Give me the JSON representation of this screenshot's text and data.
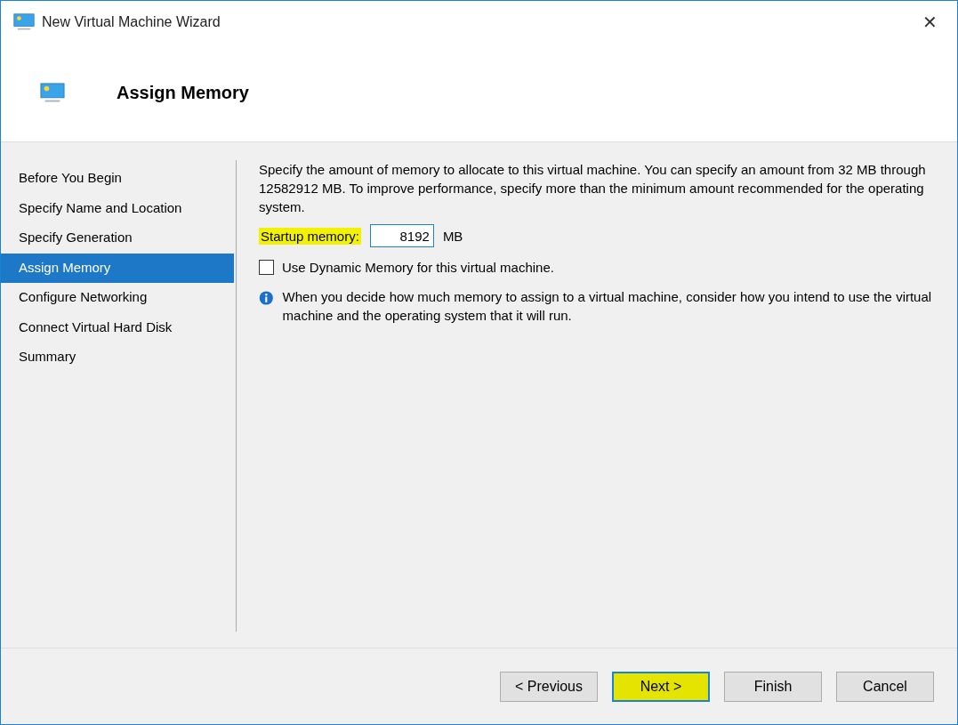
{
  "window": {
    "title": "New Virtual Machine Wizard",
    "close": "✕"
  },
  "header": {
    "title": "Assign Memory"
  },
  "sidebar": {
    "items": [
      {
        "label": "Before You Begin",
        "selected": false
      },
      {
        "label": "Specify Name and Location",
        "selected": false
      },
      {
        "label": "Specify Generation",
        "selected": false
      },
      {
        "label": "Assign Memory",
        "selected": true
      },
      {
        "label": "Configure Networking",
        "selected": false
      },
      {
        "label": "Connect Virtual Hard Disk",
        "selected": false
      },
      {
        "label": "Summary",
        "selected": false
      }
    ]
  },
  "content": {
    "description": "Specify the amount of memory to allocate to this virtual machine. You can specify an amount from 32 MB through 12582912 MB. To improve performance, specify more than the minimum amount recommended for the operating system.",
    "startup_memory": {
      "label": "Startup memory:",
      "value": "8192",
      "unit": "MB",
      "highlighted": true
    },
    "dynamic_memory": {
      "label": "Use Dynamic Memory for this virtual machine.",
      "checked": false
    },
    "info": "When you decide how much memory to assign to a virtual machine, consider how you intend to use the virtual machine and the operating system that it will run."
  },
  "buttons": [
    {
      "label": "< Previous",
      "default": false,
      "highlighted": false
    },
    {
      "label": "Next >",
      "default": true,
      "highlighted": true
    },
    {
      "label": "Finish",
      "default": false,
      "highlighted": false
    },
    {
      "label": "Cancel",
      "default": false,
      "highlighted": false
    }
  ]
}
